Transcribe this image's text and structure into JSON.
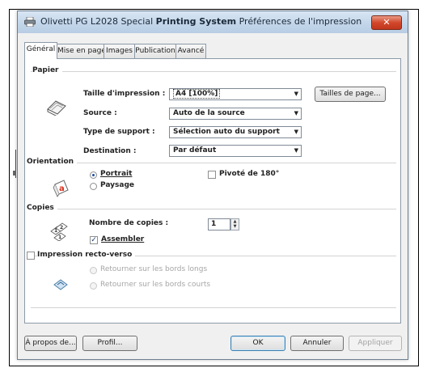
{
  "window": {
    "title_prefix": "Olivetti PG L2028 Special ",
    "title_bold": "Printing System",
    "title_suffix": " Préférences de l'impression",
    "close_label": "✕"
  },
  "tabs": [
    {
      "label": "Général",
      "active": true
    },
    {
      "label": "Mise en page",
      "active": false
    },
    {
      "label": "Images",
      "active": false
    },
    {
      "label": "Publication",
      "active": false
    },
    {
      "label": "Avancé",
      "active": false
    }
  ],
  "paper": {
    "group": "Papier",
    "size_label": "Taille d'impression :",
    "size_value": "A4  [100%]",
    "sizes_button": "Tailles de page...",
    "source_label": "Source :",
    "source_value": "Auto de la source",
    "media_label": "Type de support :",
    "media_value": "Sélection auto du support",
    "dest_label": "Destination :",
    "dest_value": "Par défaut"
  },
  "orientation": {
    "group": "Orientation",
    "portrait": "Portrait",
    "landscape": "Paysage",
    "selected": "portrait",
    "rotate_label": "Pivoté de 180°",
    "rotate_checked": false
  },
  "copies": {
    "group": "Copies",
    "count_label": "Nombre de copies :",
    "count_value": "1",
    "collate_label": "Assembler",
    "collate_checked": true
  },
  "duplex": {
    "label": "Impression recto-verso",
    "checked": false,
    "long_edge": "Retourner sur les bords longs",
    "short_edge": "Retourner sur les bords courts"
  },
  "buttons": {
    "about": "À propos de...",
    "profile": "Profil...",
    "ok": "OK",
    "cancel": "Annuler",
    "apply": "Appliquer"
  }
}
